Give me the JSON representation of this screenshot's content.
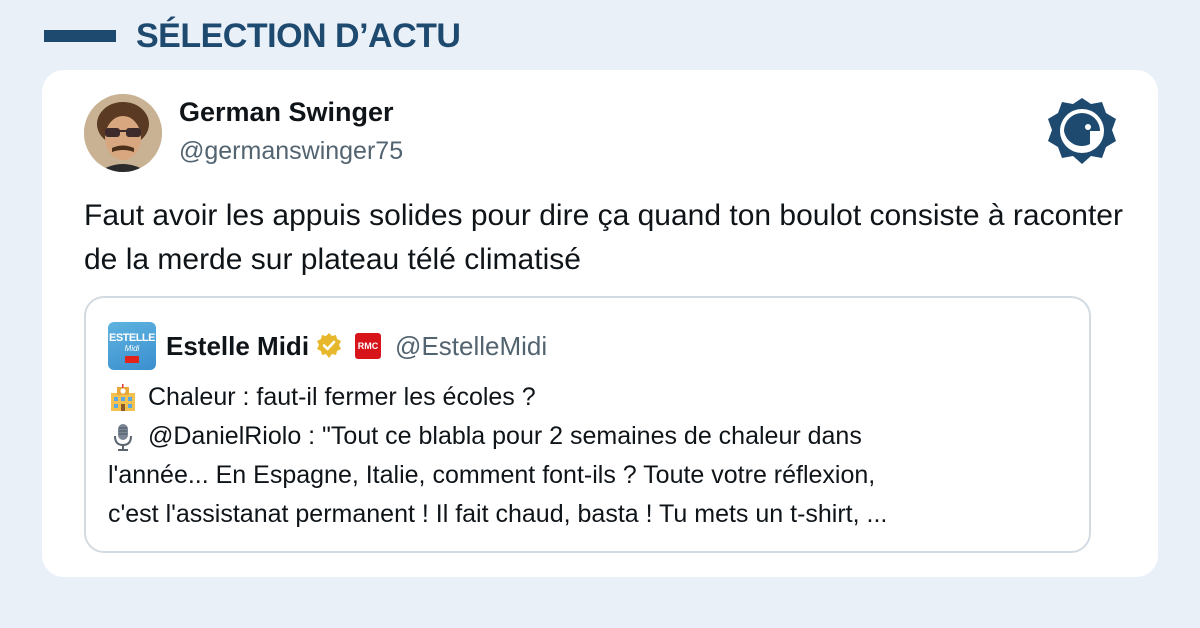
{
  "header": {
    "title": "SÉLECTION D’ACTU"
  },
  "tweet": {
    "author_name": "German Swinger",
    "author_handle": "@germanswinger75",
    "text": "Faut avoir les appuis solides pour dire ça quand ton boulot consiste à raconter de la merde sur plateau télé climatisé"
  },
  "quoted": {
    "author_name": "Estelle Midi",
    "author_handle": "@EstelleMidi",
    "avatar_text": "ESTELLE",
    "avatar_subtext": "Midi",
    "badge_text": "RMC",
    "lines": [
      "Chaleur : faut-il fermer les écoles ?",
      "@DanielRiolo : \"Tout ce blabla pour 2 semaines de chaleur dans",
      "l'année... En Espagne, Italie, comment font-ils ? Toute votre réflexion,",
      "c'est l'assistanat permanent ! Il fait chaud, basta ! Tu mets un t-shirt, ..."
    ],
    "line_icons": [
      "school-icon",
      "microphone-icon"
    ]
  },
  "colors": {
    "background": "#e9f0f8",
    "brand": "#1f4a70",
    "verified": "#e8b82c",
    "rmc": "#d7141a",
    "handle": "#536471"
  }
}
